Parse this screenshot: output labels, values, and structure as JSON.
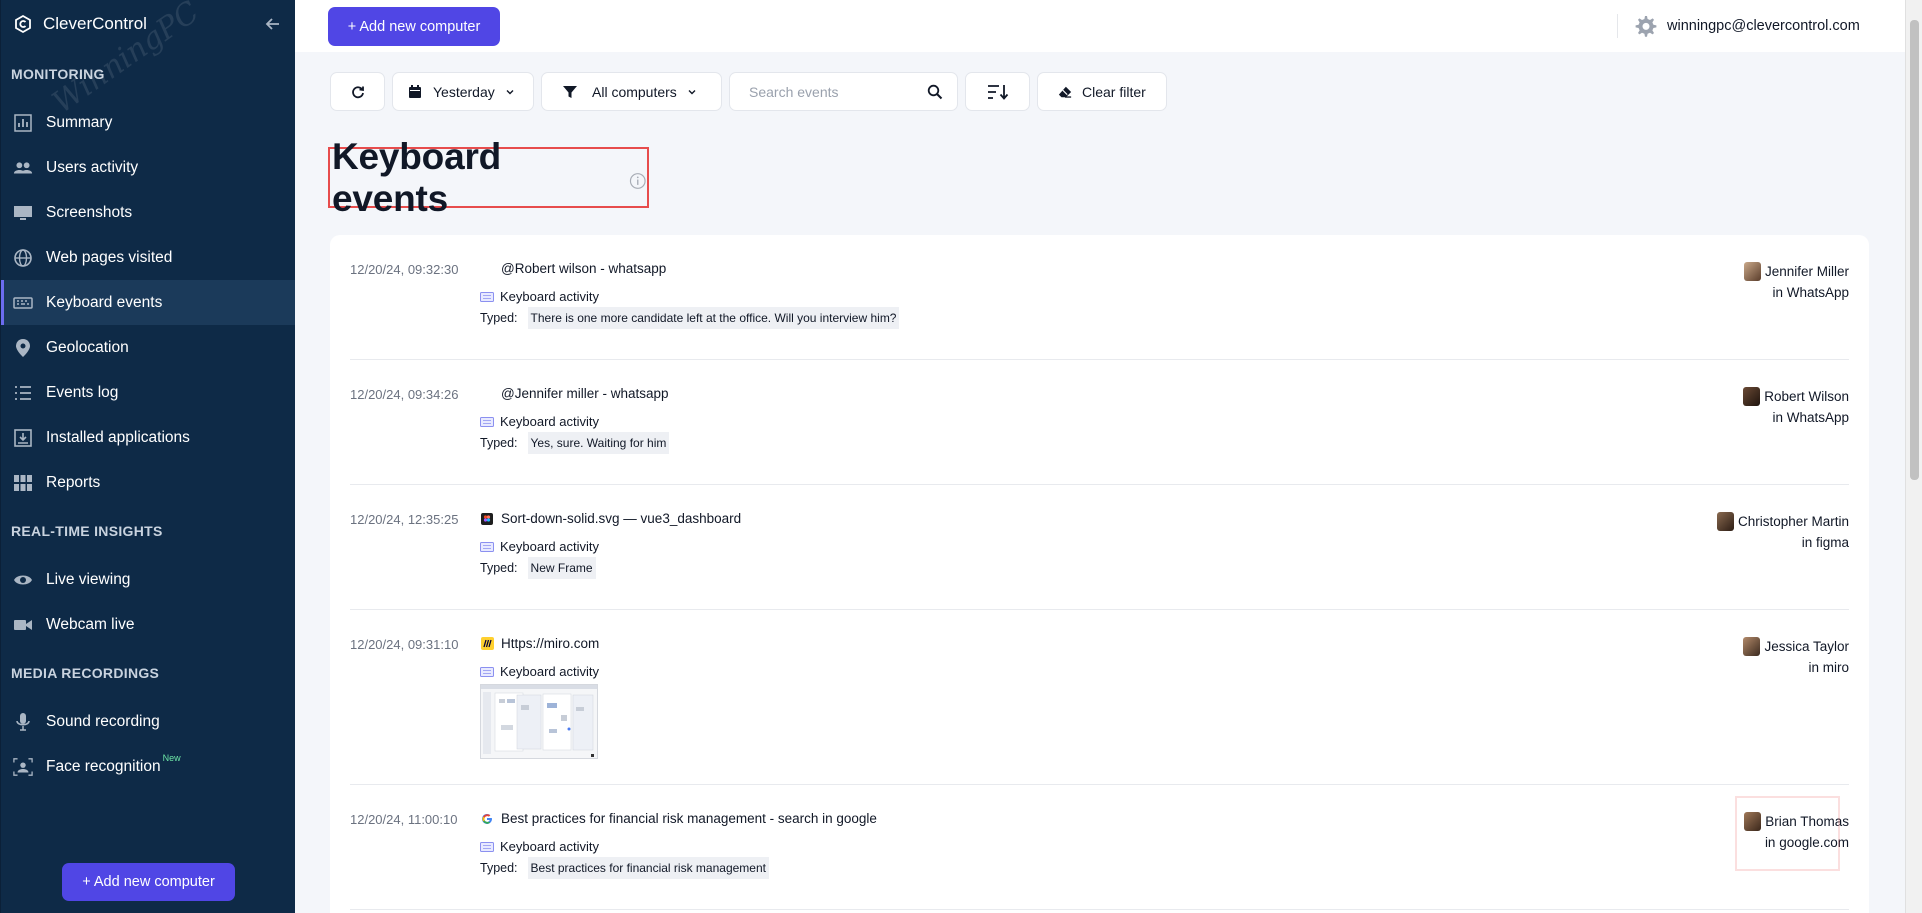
{
  "sidebar": {
    "brand": "CleverControl",
    "watermark": "WinningPC",
    "sections": {
      "monitoring": "MONITORING",
      "realtime": "REAL-TIME INSIGHTS",
      "media": "MEDIA RECORDINGS"
    },
    "items": {
      "summary": "Summary",
      "users_activity": "Users activity",
      "screenshots": "Screenshots",
      "web_pages": "Web pages visited",
      "keyboard": "Keyboard events",
      "geolocation": "Geolocation",
      "events_log": "Events log",
      "installed_apps": "Installed applications",
      "reports": "Reports",
      "live_viewing": "Live viewing",
      "webcam_live": "Webcam live",
      "sound_recording": "Sound recording",
      "face_recognition": "Face recognition",
      "new_badge": "New"
    },
    "add_button": "+ Add new computer"
  },
  "topbar": {
    "add_button": "+ Add new computer",
    "user_email": "winningpc@clevercontrol.com"
  },
  "filters": {
    "date": "Yesterday",
    "computers": "All computers",
    "search_placeholder": "Search events",
    "clear": "Clear filter"
  },
  "page": {
    "title": "Keyboard events"
  },
  "labels": {
    "keyboard_activity": "Keyboard activity",
    "typed": "Typed:"
  },
  "events": [
    {
      "time": "12/20/24, 09:32:30",
      "app": "@Robert wilson - whatsapp",
      "typed": "There is one more candidate left at the office. Will you interview him?",
      "user": "Jennifer Miller",
      "where": "in WhatsApp"
    },
    {
      "time": "12/20/24, 09:34:26",
      "app": "@Jennifer miller - whatsapp",
      "typed": "Yes, sure. Waiting for him",
      "user": "Robert Wilson",
      "where": "in WhatsApp"
    },
    {
      "time": "12/20/24, 12:35:25",
      "app": "Sort-down-solid.svg — vue3_dashboard",
      "typed": "New Frame",
      "user": "Christopher Martin",
      "where": "in figma"
    },
    {
      "time": "12/20/24, 09:31:10",
      "app": "Https://miro.com",
      "user": "Jessica Taylor",
      "where": "in miro"
    },
    {
      "time": "12/20/24, 11:00:10",
      "app": "Best practices for financial risk management - search in google",
      "typed": "Best practices for financial risk management",
      "user": "Brian Thomas",
      "where": "in google.com"
    }
  ],
  "colors": {
    "sidebar_bg": "#0e2a47",
    "accent": "#5046e5",
    "highlight_border": "#e74c4c"
  }
}
